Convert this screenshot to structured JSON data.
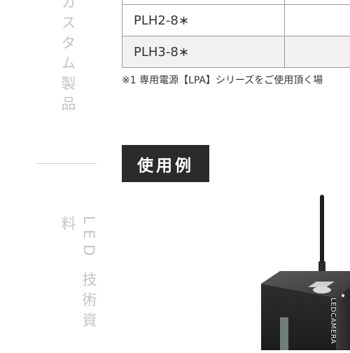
{
  "sidebar": {
    "custom_label": "カスタム製品",
    "led_label": "LED 技術資料"
  },
  "table": {
    "rows": [
      {
        "model": "",
        "value": ""
      },
      {
        "model": "PLH2-8∗",
        "value": ""
      },
      {
        "model": "PLH3-8∗",
        "value": ""
      }
    ]
  },
  "footnote": "※1 専用電源【LPA】シリーズをご使用頂く場",
  "section": {
    "heading": "使用例"
  },
  "product": {
    "label": "LEDCAMERA"
  }
}
